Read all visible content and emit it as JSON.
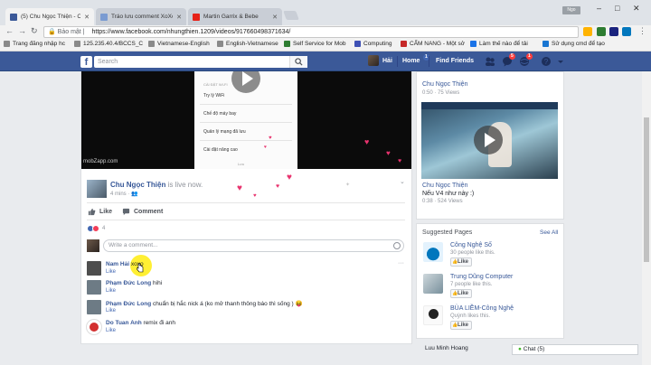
{
  "browser": {
    "tabs": [
      {
        "title": "(5) Chu Ngọc Thiện - Ch",
        "active": true,
        "favicon_color": "#3b5998"
      },
      {
        "title": "Tráo lưu comment XoXo",
        "active": false,
        "favicon_color": "#7a9bd1"
      },
      {
        "title": "Martin Garrix & Bebe",
        "active": false,
        "favicon_color": "#e62117"
      }
    ],
    "profile_badge": "Ngo",
    "security_label": "Bảo mật",
    "url": "https://www.facebook.com/nhungthien.1209/videos/917660498371634/",
    "bookmarks": [
      {
        "label": "Trang đăng nhập hc",
        "color": "#8a8a8a"
      },
      {
        "label": "125.235.40.4/BCCS_C",
        "color": "#8a8a8a"
      },
      {
        "label": "Vietnamese-English",
        "color": "#8a8a8a"
      },
      {
        "label": "English-Vietnamese",
        "color": "#8a8a8a"
      },
      {
        "label": "Self Service for Mob",
        "color": "#2e7d32"
      },
      {
        "label": "Computing",
        "color": "#3f51b5"
      },
      {
        "label": "CẨM NANG - Một sở",
        "color": "#c62828"
      },
      {
        "label": "Làm thế nào để tải",
        "color": "#1a73e8"
      },
      {
        "label": "Sử dụng cmd để tạo",
        "color": "#1976d2"
      }
    ]
  },
  "facebook": {
    "search_placeholder": "Search",
    "user_name": "Hải",
    "nav_home": "Home",
    "home_badge": "1",
    "nav_find_friends": "Find Friends",
    "notif_badges": {
      "messages": "5",
      "notifications": "1"
    }
  },
  "post": {
    "author": "Chu Ngọc Thiện",
    "status": "is live now.",
    "time": "4 mins",
    "video_watermark": "mobZapp.com",
    "phone_menu": [
      "Try lý WiFi",
      "Chế độ máy bay",
      "Chẩn đoán mạng",
      "Quản lý mạng đã lưu",
      "Cài đặt nâng cao",
      "Lưu"
    ],
    "actions": {
      "like": "Like",
      "comment": "Comment"
    },
    "reaction_count": "4",
    "comment_placeholder": "Write a comment...",
    "comments": [
      {
        "name": "Nam Hải",
        "text": "xoxo",
        "like": "Like",
        "avatar_color": "#4e4e4e"
      },
      {
        "name": "Phạm Đức Long",
        "text": "hihi",
        "like": "Like",
        "avatar_color": "#6d7b85"
      },
      {
        "name": "Phạm Đức Long",
        "text": "chuẩn bị hắc nick á (ko mở thanh thông báo thì sống ) 😝",
        "like": "Like",
        "avatar_color": "#6d7b85"
      },
      {
        "name": "Do Tuan Anh",
        "text": "remix đi anh",
        "like": "Like",
        "avatar_color": "#d32f2f"
      }
    ]
  },
  "right_column": {
    "video1": {
      "author": "Chu Ngọc Thiện",
      "meta": "0:50 · 75 Views"
    },
    "video2": {
      "author": "Chu Ngọc Thiện",
      "title": "Nếu V4 như này :)",
      "meta": "0:38 · 524 Views"
    },
    "suggested_pages_heading": "Suggested Pages",
    "see_all": "See All",
    "pages": [
      {
        "name": "Công Nghệ Số",
        "likes": "30 people like this.",
        "button": "Like",
        "color": "#0277bd"
      },
      {
        "name": "Trung Dũng Computer",
        "likes": "7 people like this.",
        "button": "Like",
        "color": "#90a4ae"
      },
      {
        "name": "BÙA LIỀM-Công Nghệ",
        "likes": "Quỳnh likes this.",
        "button": "Like",
        "color": "#212121"
      }
    ],
    "chat": {
      "contact": "Luu Minh Hoang",
      "chat_label": "Chat (5)"
    }
  }
}
